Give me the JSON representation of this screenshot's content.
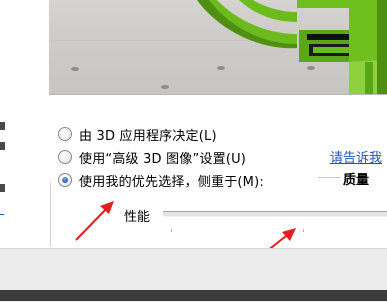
{
  "preview": {
    "description_icon": "nvidia-3d-logo-preview"
  },
  "options": {
    "app_decides": "由 3D 应用程序决定(L)",
    "advanced_settings": "使用“高级 3D 图像”设置(U)",
    "my_preference": "使用我的优先选择，侧重于(M):"
  },
  "help_link": "请告诉我",
  "slider": {
    "left_label": "性能",
    "right_label": "质量"
  },
  "colors": {
    "accent_green": "#6cbb1e",
    "arrow_red": "#e0201c",
    "link_blue": "#1f54b8"
  }
}
